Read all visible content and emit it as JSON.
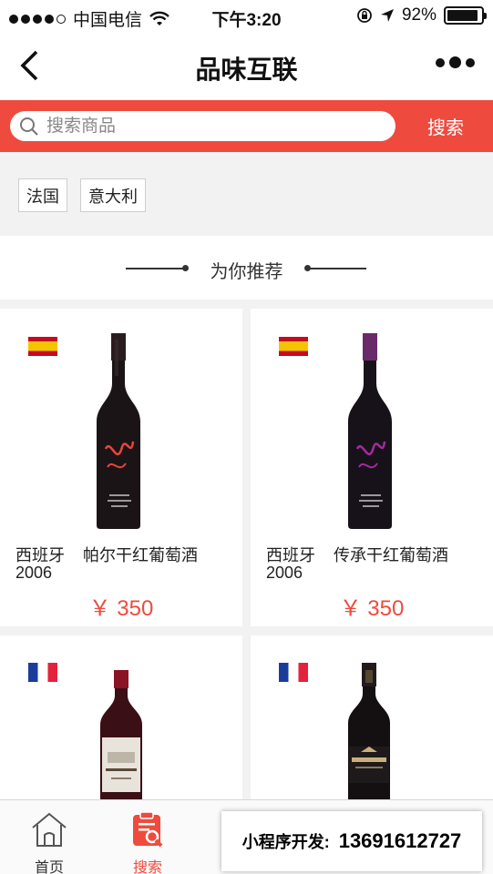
{
  "status_bar": {
    "carrier": "中国电信",
    "time": "下午3:20",
    "battery_percent": 92,
    "battery_text": "92%"
  },
  "nav": {
    "title": "品味互联",
    "back_icon": "chevron-left-icon",
    "more_icon": "more-dots-icon"
  },
  "search": {
    "placeholder": "搜索商品",
    "button_label": "搜索"
  },
  "tags": [
    "法国",
    "意大利"
  ],
  "recommend_label": "为你推荐",
  "products": [
    {
      "flag": "spain",
      "country": "西班牙",
      "name": "帕尔干红葡萄酒2006",
      "price": "￥ 350",
      "label_color": "#e8463c"
    },
    {
      "flag": "spain",
      "country": "西班牙",
      "name": "传承干红葡萄酒2006",
      "price": "￥ 350",
      "label_color": "#a52aa0"
    },
    {
      "flag": "france",
      "country": "",
      "name": "",
      "price": ""
    },
    {
      "flag": "france",
      "country": "",
      "name": "",
      "price": ""
    }
  ],
  "tab_bar": {
    "tabs": [
      {
        "label": "首页",
        "icon": "home-icon",
        "active": false
      },
      {
        "label": "搜索",
        "icon": "search-list-icon",
        "active": true
      }
    ]
  },
  "promo": {
    "label": "小程序开发:",
    "phone": "13691612727"
  },
  "colors": {
    "accent": "#ee4b3e",
    "background": "#f2f2f2"
  }
}
